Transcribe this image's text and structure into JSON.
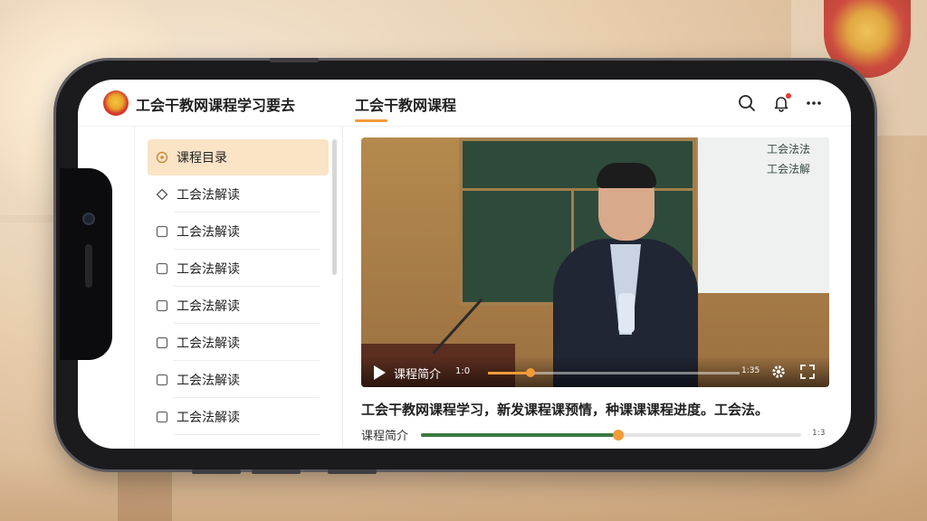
{
  "header": {
    "app_title": "工会干教网课程学习要去",
    "tab_label": "工会干教网课程"
  },
  "sidebar": {
    "items": [
      {
        "label": "课程目录",
        "icon": "catalog-icon",
        "active": true
      },
      {
        "label": "工会法解读",
        "icon": "diamond-outline-icon"
      },
      {
        "label": "工会法解读",
        "icon": "checkbox-icon"
      },
      {
        "label": "工会法解读",
        "icon": "checkbox-icon"
      },
      {
        "label": "工会法解读",
        "icon": "checkbox-icon"
      },
      {
        "label": "工会法解读",
        "icon": "checkbox-icon"
      },
      {
        "label": "工会法解读",
        "icon": "checkbox-icon"
      },
      {
        "label": "工会法解读",
        "icon": "checkbox-icon"
      }
    ]
  },
  "video": {
    "slide_lines": [
      "工会法法",
      "工会法解"
    ],
    "controls": {
      "label": "课程简介",
      "current_time": "1:0",
      "duration": "1:35",
      "progress": 0.17
    }
  },
  "content": {
    "title": "工会干教网课程学习，新发课程课预情，种课课课程进度。工会法。",
    "intro_label": "课程简介",
    "progress": 0.52,
    "time": "1:3"
  },
  "colors": {
    "accent": "#f29a38",
    "active_bg": "#fbe3c6",
    "progress_green": "#3c7a3f"
  }
}
